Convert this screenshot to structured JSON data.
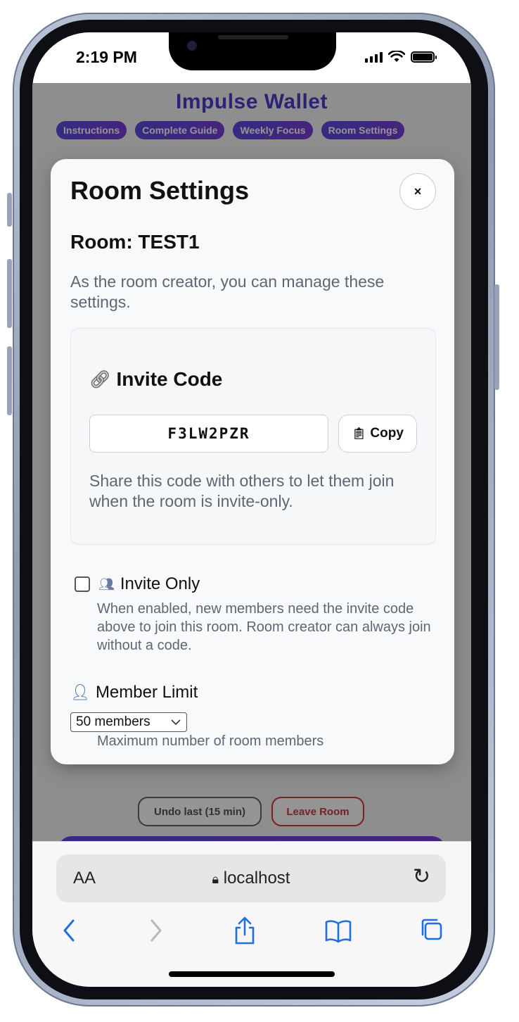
{
  "status_bar": {
    "time": "2:19 PM"
  },
  "app": {
    "title": "Impulse Wallet",
    "nav": [
      "Instructions",
      "Complete Guide",
      "Weekly Focus",
      "Room Settings"
    ]
  },
  "background": {
    "undo_label": "Undo last (15 min)",
    "leave_label": "Leave Room"
  },
  "modal": {
    "title": "Room Settings",
    "close_label": "×",
    "room_name": "Room: TEST1",
    "description": "As the room creator, you can manage these settings.",
    "invite": {
      "icon": "link-icon",
      "heading": "Invite Code",
      "code": "F3LW2PZR",
      "copy_label": "Copy",
      "hint": "Share this code with others to let them join when the room is invite-only."
    },
    "invite_only": {
      "checked": false,
      "label": "Invite Only",
      "description": "When enabled, new members need the invite code above to join this room. Room creator can always join without a code."
    },
    "member_limit": {
      "label": "Member Limit",
      "selected": "50 members",
      "hint": "Maximum number of room members"
    }
  },
  "browser": {
    "aa_label": "AA",
    "url": "localhost",
    "toolbar_icons": [
      "back-icon",
      "forward-icon",
      "share-icon",
      "bookmarks-icon",
      "tabs-icon"
    ]
  }
}
